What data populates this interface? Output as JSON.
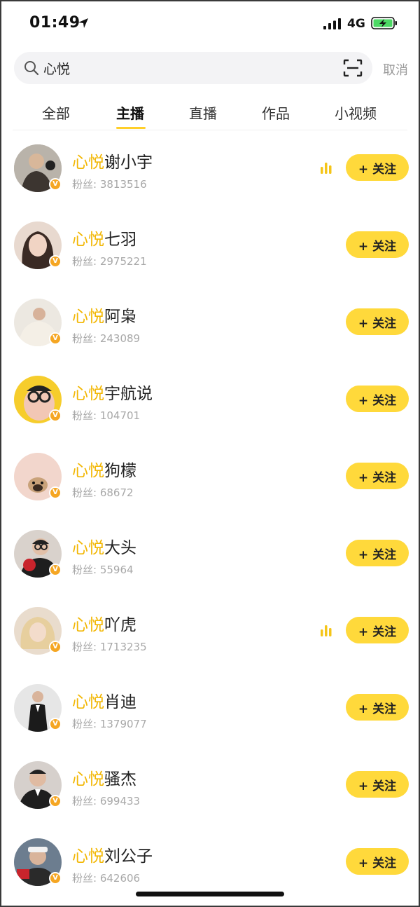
{
  "status_bar": {
    "time": "01:49",
    "network": "4G"
  },
  "search": {
    "value": "心悦",
    "placeholder": "",
    "cancel_label": "取消"
  },
  "tabs": [
    {
      "label": "全部",
      "active": false
    },
    {
      "label": "主播",
      "active": true
    },
    {
      "label": "直播",
      "active": false
    },
    {
      "label": "作品",
      "active": false
    },
    {
      "label": "小视频",
      "active": false
    }
  ],
  "accent_color": "#ffd93b",
  "highlight_color": "#f2b705",
  "fans_label": "粉丝:",
  "follow_label": "+ 关注",
  "results": [
    {
      "highlight": "心悦",
      "rest": "谢小宇",
      "fans": "3813516",
      "live": true,
      "avatar_bg": "#c9c2b8"
    },
    {
      "highlight": "心悦",
      "rest": "七羽",
      "fans": "2975221",
      "live": false,
      "avatar_bg": "#e8d9cf"
    },
    {
      "highlight": "心悦",
      "rest": "阿枭",
      "fans": "243089",
      "live": false,
      "avatar_bg": "#ece8e1"
    },
    {
      "highlight": "心悦",
      "rest": "宇航说",
      "fans": "104701",
      "live": false,
      "avatar_bg": "#f6cd2c"
    },
    {
      "highlight": "心悦",
      "rest": "狗檬",
      "fans": "68672",
      "live": false,
      "avatar_bg": "#f2d6cc"
    },
    {
      "highlight": "心悦",
      "rest": "大头",
      "fans": "55964",
      "live": false,
      "avatar_bg": "#d9d2cc"
    },
    {
      "highlight": "心悦",
      "rest": "吖虎",
      "fans": "1713235",
      "live": true,
      "avatar_bg": "#e9dccd"
    },
    {
      "highlight": "心悦",
      "rest": "肖迪",
      "fans": "1379077",
      "live": false,
      "avatar_bg": "#e6e6e6"
    },
    {
      "highlight": "心悦",
      "rest": "骚杰",
      "fans": "699433",
      "live": false,
      "avatar_bg": "#d6d0cc"
    },
    {
      "highlight": "心悦",
      "rest": "刘公子",
      "fans": "642606",
      "live": false,
      "avatar_bg": "#6c7d8f"
    }
  ]
}
